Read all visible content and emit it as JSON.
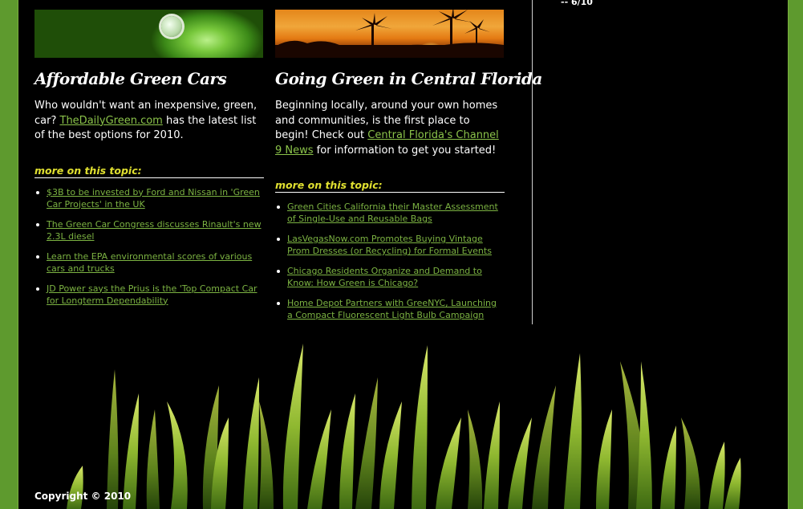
{
  "column1": {
    "headline": "Affordable Green Cars",
    "body": {
      "text_before": "Who wouldn't want an inexpensive, green, car? ",
      "link": "TheDailyGreen.com",
      "text_after": " has the latest list of the best options for 2010."
    },
    "more_label": "more on this topic:",
    "links": [
      "$3B to be invested by Ford and Nissan in 'Green Car Projects' in the UK",
      "The Green Car Congress discusses Rinault's new 2.3L diesel",
      "Learn the EPA environmental scores of various cars and trucks",
      "JD Power says the Prius is the 'Top Compact Car for Longterm Dependability"
    ]
  },
  "column2": {
    "headline": "Going Green in Central Florida",
    "body": {
      "text_before": "Beginning locally, around your own homes and communities, is the first place to begin! Check out ",
      "link": "Central Florida's Channel 9 News",
      "text_after": " for information to get you started!"
    },
    "more_label": "more on this topic:",
    "links": [
      "Green Cities California their Master Assessment of Single-Use and Reusable Bags",
      "LasVegasNow.com Promotes Buying Vintage Prom Dresses (or Recycling) for Formal Events",
      "Chicago Residents Organize and Demand to Know: How Green is Chicago?",
      "Home Depot Partners with GreeNYC, Launching a Compact Fluorescent Light Bulb Campaign"
    ]
  },
  "sidebar": {
    "date_note": "-- 6/10"
  },
  "footer": {
    "copyright": "Copyright © 2010"
  },
  "colors": {
    "frame": "#5e9a2e",
    "link": "#7cb342",
    "topic_label": "#e0e030"
  }
}
